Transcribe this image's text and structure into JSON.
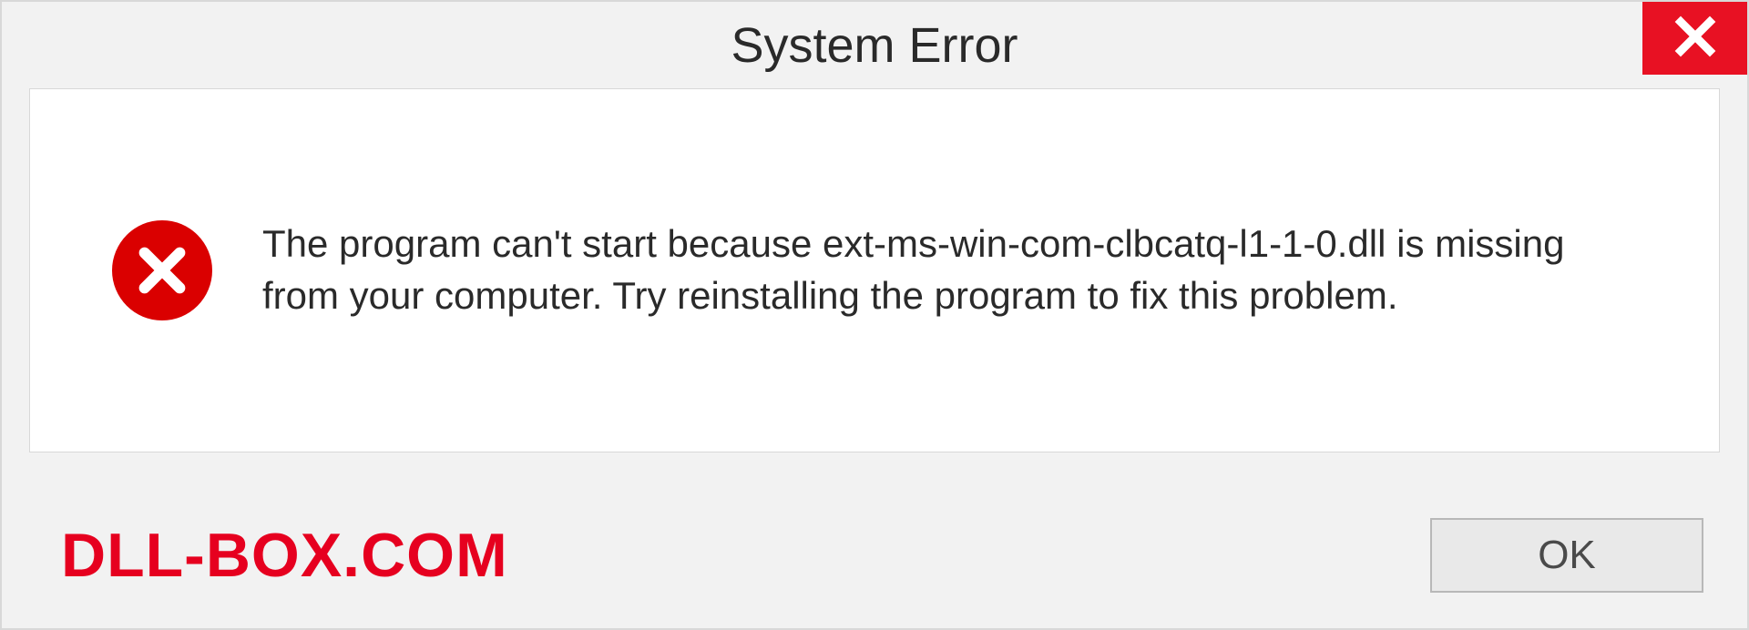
{
  "dialog": {
    "title": "System Error",
    "message": "The program can't start because ext-ms-win-com-clbcatq-l1-1-0.dll is missing from your computer. Try reinstalling the program to fix this problem.",
    "ok_label": "OK",
    "watermark": "DLL-BOX.COM"
  },
  "colors": {
    "close_bg": "#e81123",
    "error_icon": "#da0000",
    "watermark": "#e6001f"
  }
}
